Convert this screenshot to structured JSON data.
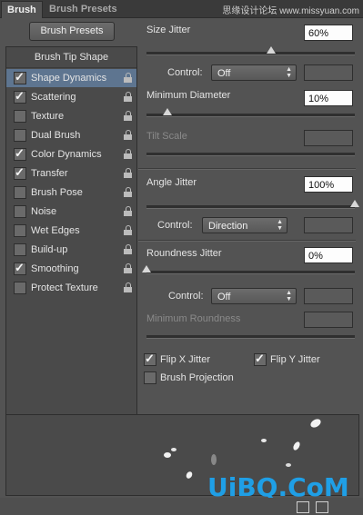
{
  "tabs": {
    "brush": "Brush",
    "presets": "Brush Presets"
  },
  "watermark_top": "思缘设计论坛 www.missyuan.com",
  "brush_presets_button": "Brush Presets",
  "brush_tip_shape": "Brush Tip Shape",
  "options": [
    {
      "label": "Shape Dynamics",
      "checked": "✓",
      "selected": true
    },
    {
      "label": "Scattering",
      "checked": "✓"
    },
    {
      "label": "Texture",
      "checked": ""
    },
    {
      "label": "Dual Brush",
      "checked": ""
    },
    {
      "label": "Color Dynamics",
      "checked": "✓"
    },
    {
      "label": "Transfer",
      "checked": "✓"
    },
    {
      "label": "Brush Pose",
      "checked": ""
    },
    {
      "label": "Noise",
      "checked": ""
    },
    {
      "label": "Wet Edges",
      "checked": ""
    },
    {
      "label": "Build-up",
      "checked": ""
    },
    {
      "label": "Smoothing",
      "checked": "✓"
    },
    {
      "label": "Protect Texture",
      "checked": ""
    }
  ],
  "size_jitter": {
    "label": "Size Jitter",
    "value": "60%",
    "level": 0.6
  },
  "control1": {
    "label": "Control:",
    "value": "Off"
  },
  "min_diameter": {
    "label": "Minimum Diameter",
    "value": "10%",
    "level": 0.1
  },
  "tilt_scale": {
    "label": "Tilt Scale"
  },
  "angle_jitter": {
    "label": "Angle Jitter",
    "value": "100%",
    "level": 1.0
  },
  "control2": {
    "label": "Control:",
    "value": "Direction"
  },
  "roundness_jitter": {
    "label": "Roundness Jitter",
    "value": "0%",
    "level": 0.0
  },
  "control3": {
    "label": "Control:",
    "value": "Off"
  },
  "min_roundness": {
    "label": "Minimum Roundness"
  },
  "flip_x": {
    "label": "Flip X Jitter",
    "checked": "✓"
  },
  "flip_y": {
    "label": "Flip Y Jitter",
    "checked": "✓"
  },
  "brush_projection": {
    "label": "Brush Projection",
    "checked": ""
  },
  "brand": "UiBQ.CoM",
  "brand_sub": "UiBQ.CoM"
}
